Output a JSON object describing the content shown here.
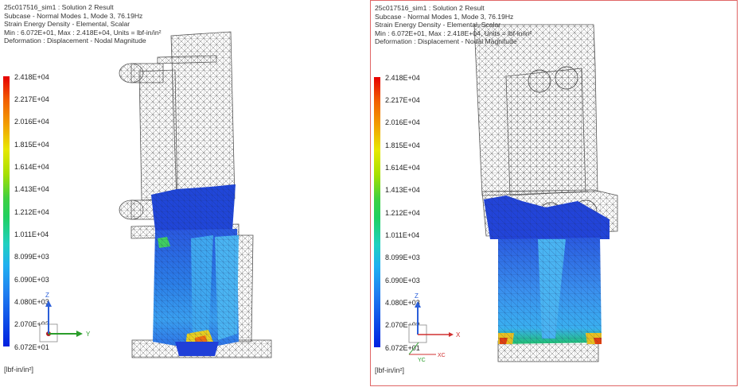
{
  "colors": {
    "active_border": "#e06666",
    "mesh": "#555555",
    "accent_blue": "#2b5fd9",
    "axis_green": "#2a9d2a",
    "axis_red": "#d03030"
  },
  "viewports": [
    {
      "header": [
        "25c017516_sim1 : Solution 2 Result",
        "Subcase - Normal Modes 1, Mode 3, 76.19Hz",
        "Strain Energy Density - Elemental, Scalar",
        "Min : 6.072E+01, Max : 2.418E+04, Units = lbf-in/in²",
        "Deformation : Displacement - Nodal Magnitude"
      ],
      "legend": [
        "2.418E+04",
        "2.217E+04",
        "2.016E+04",
        "1.815E+04",
        "1.614E+04",
        "1.413E+04",
        "1.212E+04",
        "1.011E+04",
        "8.099E+03",
        "6.090E+03",
        "4.080E+03",
        "2.070E+03",
        "6.072E+01"
      ],
      "units": "[lbf-in/in²]",
      "axis": {
        "up": "Z",
        "right": "Y"
      }
    },
    {
      "header": [
        "25c017516_sim1 : Solution 2 Result",
        "Subcase - Normal Modes 1, Mode 3, 76.19Hz",
        "Strain Energy Density - Elemental, Scalar",
        "Min : 6.072E+01, Max : 2.418E+04, Units = lbf-in/in²",
        "Deformation : Displacement - Nodal Magnitude"
      ],
      "legend": [
        "2.418E+04",
        "2.217E+04",
        "2.016E+04",
        "1.815E+04",
        "1.614E+04",
        "1.413E+04",
        "1.212E+04",
        "1.011E+04",
        "8.099E+03",
        "6.090E+03",
        "4.080E+03",
        "2.070E+03",
        "6.072E+01"
      ],
      "units": "[lbf-in/in²]",
      "axis": {
        "up": "Z",
        "right": "X",
        "diag_a": "YC",
        "diag_b": "XC"
      }
    }
  ]
}
